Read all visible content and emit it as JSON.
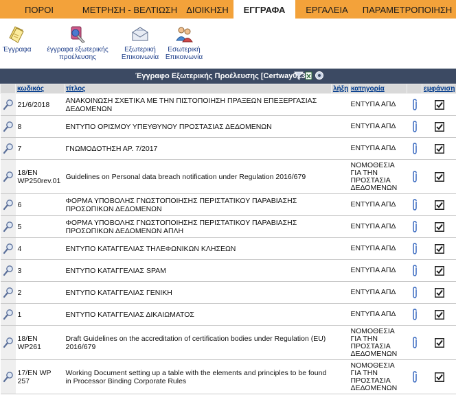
{
  "tabs": [
    {
      "label": "ΠΟΡΟΙ",
      "active": false
    },
    {
      "label": "ΜΕΤΡΗΣΗ - ΒΕΛΤΙΩΣΗ",
      "active": false
    },
    {
      "label": "ΔΙΟΙΚΗΣΗ",
      "active": false
    },
    {
      "label": "ΕΓΓΡΑΦΑ",
      "active": true
    },
    {
      "label": "ΕΡΓΑΛΕΙΑ",
      "active": false
    },
    {
      "label": "ΠΑΡΑΜΕΤΡΟΠΟΙΗΣΗ",
      "active": false
    }
  ],
  "toolbar": {
    "documents": "Έγγραφα",
    "external_docs": "έγγραφα εξωτερικής προέλευσης",
    "external_comm": "Εξωτερική Επικοινωνία",
    "internal_comm": "Εσωτερική Επικοινωνία"
  },
  "header_bar": {
    "title": "Έγγραφο Εξωτερικής Προέλευσης [Certway013]"
  },
  "columns": {
    "code": "κωδικός",
    "title": "τίτλος",
    "expiry": "λήξη",
    "category": "κατηγορία",
    "display": "εμφάνιση"
  },
  "rows": [
    {
      "code": "21/6/2018",
      "title": "ΑΝΑΚΟΙΝΩΣΗ ΣΧΕΤΙΚΑ ΜΕ ΤΗΝ ΠΙΣΤΟΠΟΙΗΣΗ ΠΡΑΞΕΩΝ ΕΠΕΞΕΡΓΑΣΙΑΣ ΔΕΔΟΜΕΝΩΝ",
      "expiry": "",
      "category": "ΕΝΤΥΠΑ ΑΠΔ",
      "display": true
    },
    {
      "code": "8",
      "title": "ΕΝΤΥΠΟ ΟΡΙΣΜΟΥ ΥΠΕΥΘΥΝΟΥ ΠΡΟΣΤΑΣΙΑΣ ΔΕΔΟΜΕΝΩΝ",
      "expiry": "",
      "category": "ΕΝΤΥΠΑ ΑΠΔ",
      "display": true
    },
    {
      "code": "7",
      "title": "ΓΝΩΜΟΔΟΤΗΣΗ ΑΡ. 7/2017",
      "expiry": "",
      "category": "ΕΝΤΥΠΑ ΑΠΔ",
      "display": true
    },
    {
      "code": "18/EN WP250rev.01",
      "title": "Guidelines on Personal data breach notification under Regulation 2016/679",
      "expiry": "",
      "category": "ΝΟΜΟΘΕΣΙΑ ΓΙΑ ΤΗΝ ΠΡΟΣΤΑΣΙΑ ΔΕΔΟΜΕΝΩΝ",
      "display": true
    },
    {
      "code": "6",
      "title": "ΦΟΡΜΑ ΥΠΟΒΟΛΗΣ ΓΝΩΣΤΟΠΟΙΗΣΗΣ ΠΕΡΙΣΤΑΤΙΚΟΥ ΠΑΡΑΒΙΑΣΗΣ ΠΡΟΣΩΠΙΚΩΝ ΔΕΔΟΜΕΝΩΝ",
      "expiry": "",
      "category": "ΕΝΤΥΠΑ ΑΠΔ",
      "display": true
    },
    {
      "code": "5",
      "title": "ΦΟΡΜΑ ΥΠΟΒΟΛΗΣ ΓΝΩΣΤΟΠΟΙΗΣΗΣ ΠΕΡΙΣΤΑΤΙΚΟΥ ΠΑΡΑΒΙΑΣΗΣ ΠΡΟΣΩΠΙΚΩΝ ΔΕΔΟΜΕΝΩΝ ΑΠΛΗ",
      "expiry": "",
      "category": "ΕΝΤΥΠΑ ΑΠΔ",
      "display": true
    },
    {
      "code": "4",
      "title": "ΕΝΤΥΠΟ ΚΑΤΑΓΓΕΛΙΑΣ ΤΗΛΕΦΩΝΙΚΩΝ ΚΛΗΣΕΩΝ",
      "expiry": "",
      "category": "ΕΝΤΥΠΑ ΑΠΔ",
      "display": true
    },
    {
      "code": "3",
      "title": "ΕΝΤΥΠΟ ΚΑΤΑΓΓΕΛΙΑΣ SPAM",
      "expiry": "",
      "category": "ΕΝΤΥΠΑ ΑΠΔ",
      "display": true
    },
    {
      "code": "2",
      "title": "ΕΝΤΥΠΟ ΚΑΤΑΓΓΕΛΙΑΣ ΓΕΝΙΚΗ",
      "expiry": "",
      "category": "ΕΝΤΥΠΑ ΑΠΔ",
      "display": true
    },
    {
      "code": "1",
      "title": "ΕΝΤΥΠΟ ΚΑΤΑΓΓΕΛΙΑΣ ΔΙΚΑΙΩΜΑΤΟΣ",
      "expiry": "",
      "category": "ΕΝΤΥΠΑ ΑΠΔ",
      "display": true
    },
    {
      "code": "18/EN WP261",
      "title": "Draft Guidelines on the accreditation of certification bodies under Regulation (EU) 2016/679",
      "expiry": "",
      "category": "ΝΟΜΟΘΕΣΙΑ ΓΙΑ ΤΗΝ ΠΡΟΣΤΑΣΙΑ ΔΕΔΟΜΕΝΩΝ",
      "display": true
    },
    {
      "code": "17/EN WP 257",
      "title": "Working Document setting up a table with the elements and principles to be found in Processor Binding Corporate Rules",
      "expiry": "",
      "category": "ΝΟΜΟΘΕΣΙΑ ΓΙΑ ΤΗΝ ΠΡΟΣΤΑΣΙΑ ΔΕΔΟΜΕΝΩΝ",
      "display": true
    }
  ],
  "icons": {
    "view": "magnifier-icon",
    "attachment": "paperclip-icon",
    "checkbox": "checkbox-checked-icon",
    "filter": "filter-icon"
  },
  "colors": {
    "tab_bar": "#f3a23a",
    "header_bar": "#3c4a63",
    "link": "#003a8c"
  }
}
